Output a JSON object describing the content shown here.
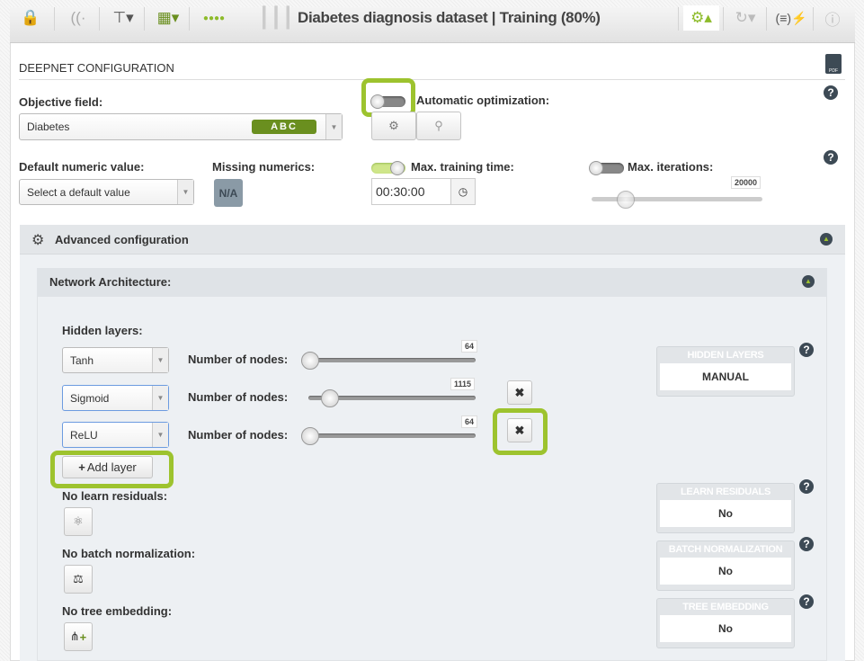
{
  "toolbar": {
    "title": "Diabetes diagnosis dataset | Training (80%)",
    "icons": [
      "lock-icon",
      "analyze-icon",
      "tree-icon",
      "counter-icon",
      "dots-icon",
      "bars-icon",
      "gears-icon",
      "sync-icon",
      "formula-icon",
      "info-icon"
    ]
  },
  "config": {
    "section_title": "DEEPNET CONFIGURATION",
    "pdf_label": "PDF",
    "objective_label": "Objective field:",
    "objective_value": "Diabetes",
    "objective_type": "ABC",
    "auto_opt_label": "Automatic optimization:",
    "auto_opt_on": false,
    "default_numeric_label": "Default numeric value:",
    "default_numeric_placeholder": "Select a default value",
    "missing_label": "Missing numerics:",
    "missing_btn": "N/A",
    "max_time_label": "Max. training time:",
    "max_time_on": true,
    "max_time_value": "00:30:00",
    "max_iter_label": "Max. iterations:",
    "max_iter_on": false,
    "max_iter_value": "20000"
  },
  "advanced": {
    "title": "Advanced configuration"
  },
  "network": {
    "title": "Network Architecture:",
    "hidden_label": "Hidden layers:",
    "layers": [
      {
        "activation": "Tanh",
        "nodes_label": "Number of nodes:",
        "nodes": "64"
      },
      {
        "activation": "Sigmoid",
        "nodes_label": "Number of nodes:",
        "nodes": "1115"
      },
      {
        "activation": "ReLU",
        "nodes_label": "Number of nodes:",
        "nodes": "64"
      }
    ],
    "add_layer": "Add layer",
    "residuals_label": "No learn residuals:",
    "batch_label": "No batch normalization:",
    "tree_label": "No tree embedding:",
    "cards": [
      {
        "title": "HIDDEN LAYERS",
        "value": "MANUAL"
      },
      {
        "title": "LEARN RESIDUALS",
        "value": "No"
      },
      {
        "title": "BATCH NORMALIZATION",
        "value": "No"
      },
      {
        "title": "TREE EMBEDDING",
        "value": "No"
      }
    ]
  },
  "colors": {
    "accent": "#9dc32e",
    "type_badge": "#6a8f1f"
  }
}
